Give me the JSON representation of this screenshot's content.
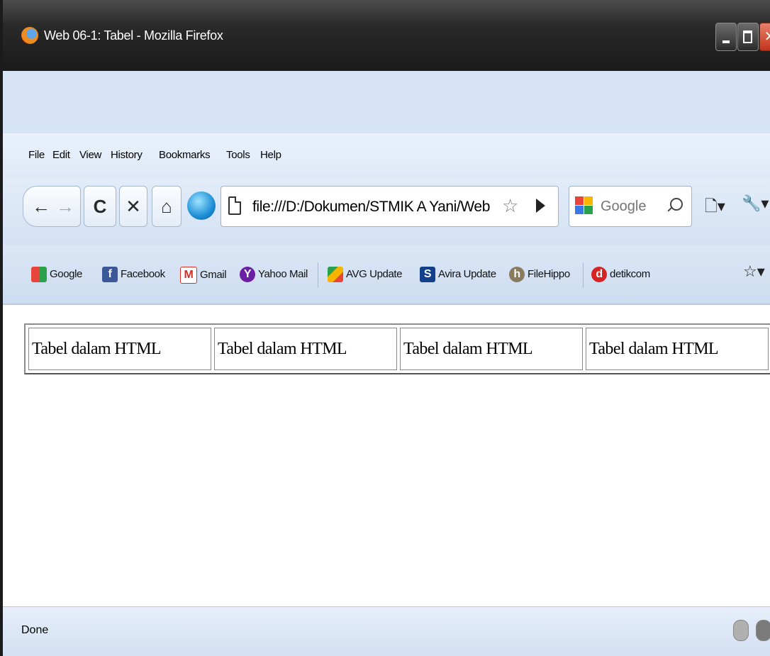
{
  "window": {
    "title": "Web 06-1: Tabel - Mozilla Firefox",
    "controls": {
      "minimize": "minimize",
      "maximize": "maximize",
      "close": "close"
    }
  },
  "menu": {
    "items": [
      {
        "label": "File"
      },
      {
        "label": "Edit"
      },
      {
        "label": "View"
      },
      {
        "label": "History"
      },
      {
        "label": "Bookmarks"
      },
      {
        "label": "Tools"
      },
      {
        "label": "Help"
      }
    ]
  },
  "nav": {
    "buttons": [
      "back-icon",
      "forward-icon",
      "reload-icon",
      "stop-icon",
      "home-icon",
      "stylish-addon-icon"
    ],
    "url": "file:///D:/Dokumen/STMIK A Yani/Web",
    "search_placeholder": "Google",
    "tools": [
      "page-menu-icon",
      "tools-menu-icon"
    ]
  },
  "bookmarks": [
    {
      "label": "Google",
      "icon": "google-icon"
    },
    {
      "label": "Facebook",
      "icon": "facebook-icon"
    },
    {
      "label": "Gmail",
      "icon": "gmail-icon"
    },
    {
      "label": "Yahoo Mail",
      "icon": "yahoo-icon"
    },
    {
      "label": "AVG Update",
      "icon": "avg-icon"
    },
    {
      "label": "Avira Update",
      "icon": "avira-icon"
    },
    {
      "label": "FileHippo",
      "icon": "filehippo-icon"
    },
    {
      "label": "detikcom",
      "icon": "detik-icon"
    }
  ],
  "content": {
    "table": {
      "rows": [
        [
          "Tabel dalam HTML",
          "Tabel dalam HTML",
          "Tabel dalam HTML",
          "Tabel dalam HTML"
        ]
      ]
    }
  },
  "status": {
    "text": "Done"
  },
  "colors": {
    "titlebar": "#1a1a1a",
    "chrome": "#d9e6f6",
    "close": "#c2341a"
  }
}
